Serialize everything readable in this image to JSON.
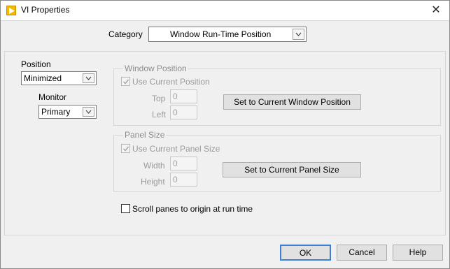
{
  "window": {
    "title": "VI Properties",
    "close_icon": "close-icon"
  },
  "category": {
    "label": "Category",
    "value": "Window Run-Time Position"
  },
  "position": {
    "label": "Position",
    "value": "Minimized"
  },
  "monitor": {
    "label": "Monitor",
    "value": "Primary"
  },
  "window_position": {
    "title": "Window Position",
    "use_current_label": "Use Current Position",
    "use_current_checked": true,
    "top_label": "Top",
    "top_value": "0",
    "left_label": "Left",
    "left_value": "0",
    "set_button": "Set to Current Window Position"
  },
  "panel_size": {
    "title": "Panel Size",
    "use_current_label": "Use Current Panel Size",
    "use_current_checked": true,
    "width_label": "Width",
    "width_value": "0",
    "height_label": "Height",
    "height_value": "0",
    "set_button": "Set to Current Panel Size"
  },
  "scroll_panes": {
    "label": "Scroll panes to origin at run time",
    "checked": false
  },
  "buttons": {
    "ok": "OK",
    "cancel": "Cancel",
    "help": "Help"
  },
  "colors": {
    "accent": "#3c7fd4",
    "icon": "#f5b800",
    "background": "#f0f0f0"
  }
}
